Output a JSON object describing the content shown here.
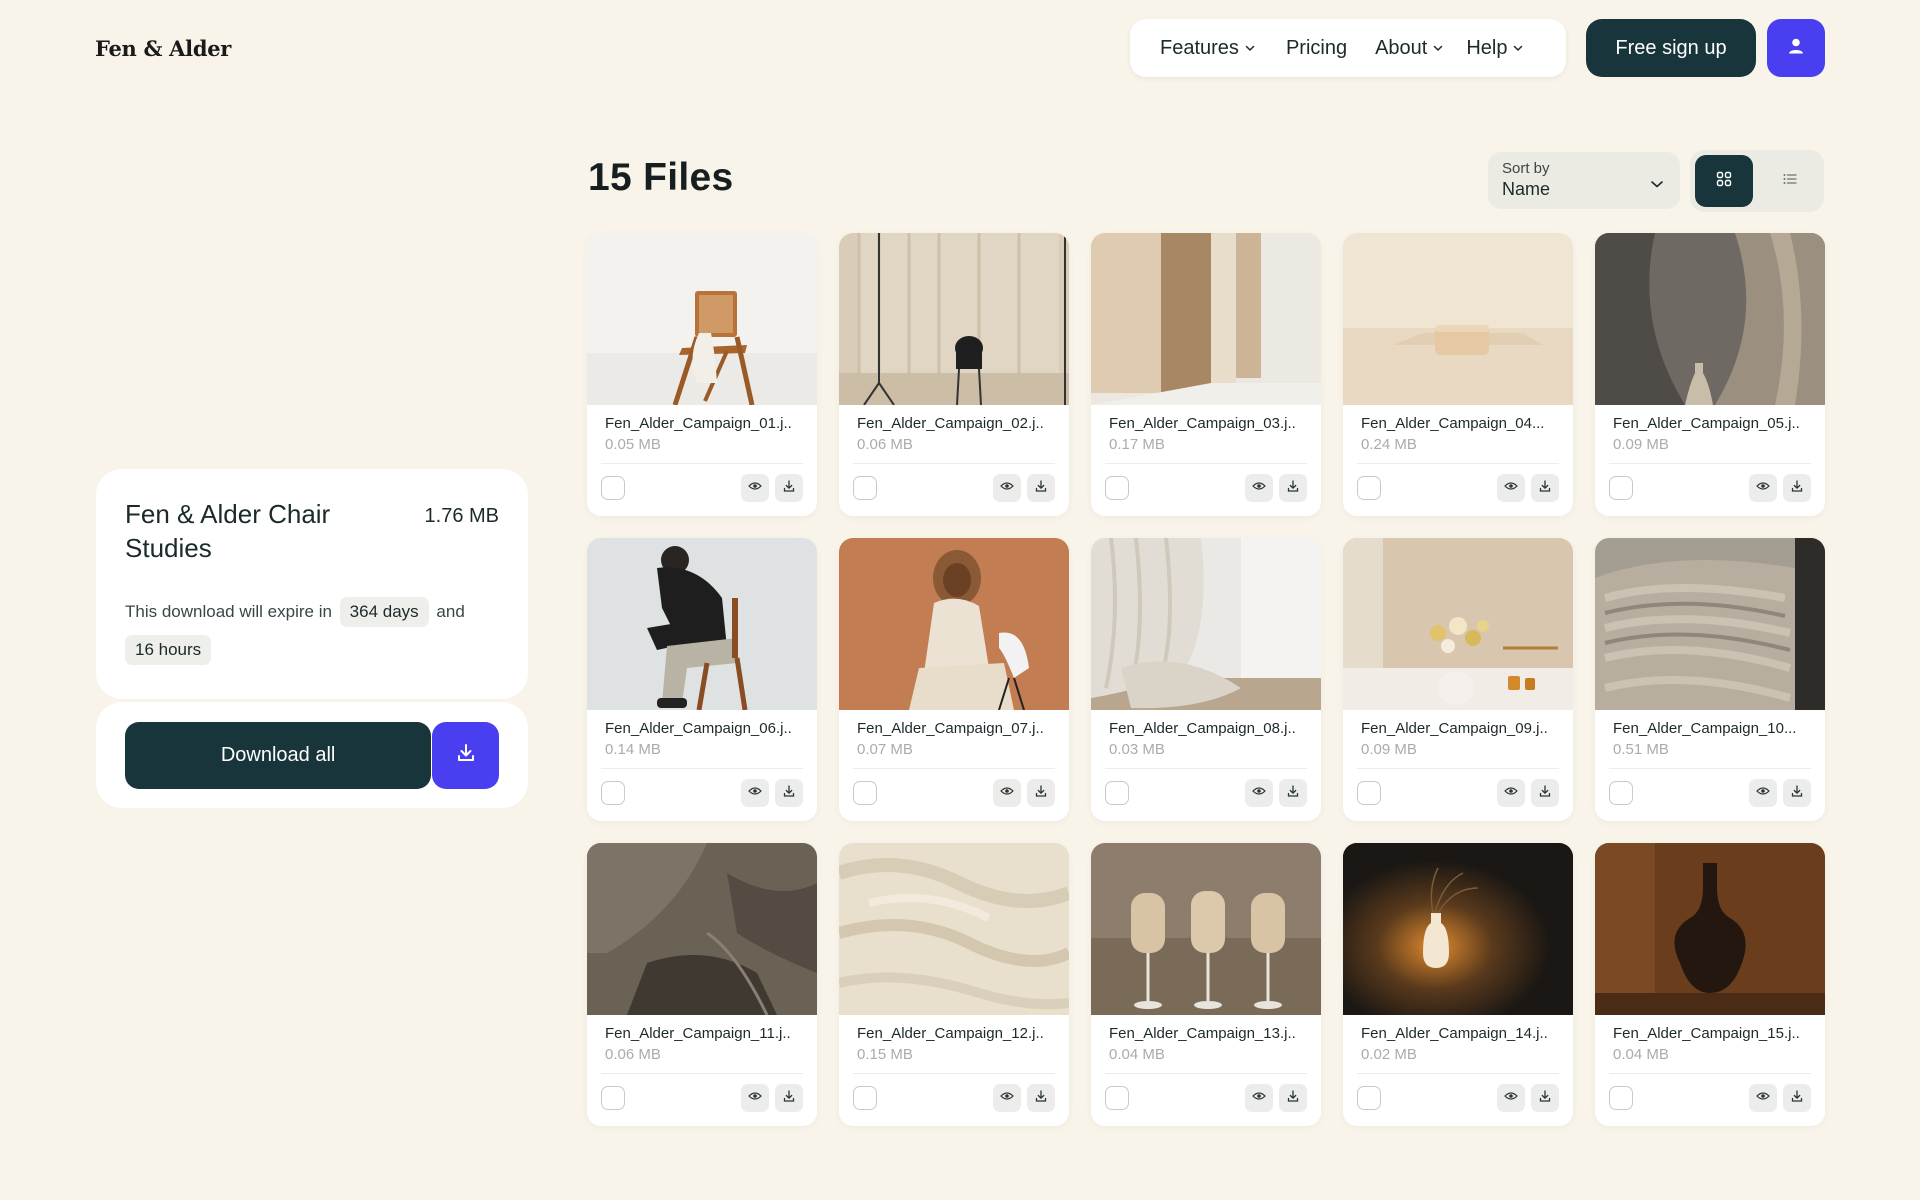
{
  "brand": {
    "name": "Fen & Alder"
  },
  "nav": {
    "items": [
      {
        "label": "Features",
        "has_dropdown": true
      },
      {
        "label": "Pricing",
        "has_dropdown": false
      },
      {
        "label": "About",
        "has_dropdown": true
      },
      {
        "label": "Help",
        "has_dropdown": true
      }
    ],
    "signup_label": "Free sign up",
    "user_icon": "user-icon"
  },
  "collection": {
    "title": "Fen & Alder Chair Studies",
    "size": "1.76 MB",
    "expire_prefix": "This download will expire in",
    "expire_days": "364 days",
    "expire_and": "and",
    "expire_hours": "16 hours",
    "download_all_label": "Download all",
    "download_icon": "download-icon"
  },
  "files_header": {
    "title": "15 Files",
    "sort_label": "Sort by",
    "sort_value": "Name",
    "view_modes": [
      "grid",
      "list"
    ],
    "active_view": "grid"
  },
  "files": [
    {
      "name": "Fen_Alder_Campaign_01.j..",
      "size": "0.05 MB"
    },
    {
      "name": "Fen_Alder_Campaign_02.j..",
      "size": "0.06 MB"
    },
    {
      "name": "Fen_Alder_Campaign_03.j..",
      "size": "0.17 MB"
    },
    {
      "name": "Fen_Alder_Campaign_04...",
      "size": "0.24 MB"
    },
    {
      "name": "Fen_Alder_Campaign_05.j..",
      "size": "0.09 MB"
    },
    {
      "name": "Fen_Alder_Campaign_06.j..",
      "size": "0.14 MB"
    },
    {
      "name": "Fen_Alder_Campaign_07.j..",
      "size": "0.07 MB"
    },
    {
      "name": "Fen_Alder_Campaign_08.j..",
      "size": "0.03 MB"
    },
    {
      "name": "Fen_Alder_Campaign_09.j..",
      "size": "0.09 MB"
    },
    {
      "name": "Fen_Alder_Campaign_10...",
      "size": "0.51 MB"
    },
    {
      "name": "Fen_Alder_Campaign_11.j..",
      "size": "0.06 MB"
    },
    {
      "name": "Fen_Alder_Campaign_12.j..",
      "size": "0.15 MB"
    },
    {
      "name": "Fen_Alder_Campaign_13.j..",
      "size": "0.04 MB"
    },
    {
      "name": "Fen_Alder_Campaign_14.j..",
      "size": "0.02 MB"
    },
    {
      "name": "Fen_Alder_Campaign_15.j..",
      "size": "0.04 MB"
    }
  ],
  "colors": {
    "background": "#f8f4ea",
    "primary_dark": "#17353a",
    "accent": "#4a3ff0"
  }
}
